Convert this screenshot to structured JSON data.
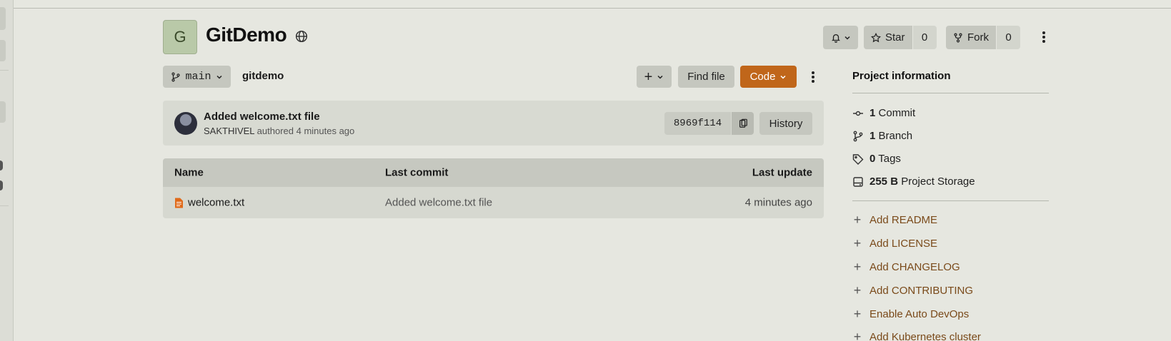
{
  "project": {
    "initial": "G",
    "name": "GitDemo"
  },
  "header": {
    "star_label": "Star",
    "star_count": "0",
    "fork_label": "Fork",
    "fork_count": "0"
  },
  "repo_bar": {
    "branch": "main",
    "breadcrumb": "gitdemo",
    "find_file_label": "Find file",
    "code_label": "Code",
    "code_color": "#c0661a"
  },
  "last_commit": {
    "title": "Added welcome.txt file",
    "author": "SAKTHIVEL",
    "meta": "authored 4 minutes ago",
    "sha": "8969f114",
    "history_label": "History"
  },
  "file_table": {
    "headers": {
      "name": "Name",
      "last_commit": "Last commit",
      "last_update": "Last update"
    },
    "rows": [
      {
        "name": "welcome.txt",
        "last_commit": "Added welcome.txt file",
        "last_update": "4 minutes ago",
        "icon": "file-text-icon"
      }
    ]
  },
  "project_info": {
    "title": "Project information",
    "stats": [
      {
        "count": "1",
        "label": "Commit",
        "icon": "commit-icon"
      },
      {
        "count": "1",
        "label": "Branch",
        "icon": "branch-icon"
      },
      {
        "count": "0",
        "label": "Tags",
        "icon": "tag-icon"
      },
      {
        "count": "255 B",
        "label": "Project Storage",
        "icon": "storage-icon"
      }
    ],
    "actions": [
      "Add README",
      "Add LICENSE",
      "Add CHANGELOG",
      "Add CONTRIBUTING",
      "Enable Auto DevOps",
      "Add Kubernetes cluster"
    ]
  }
}
